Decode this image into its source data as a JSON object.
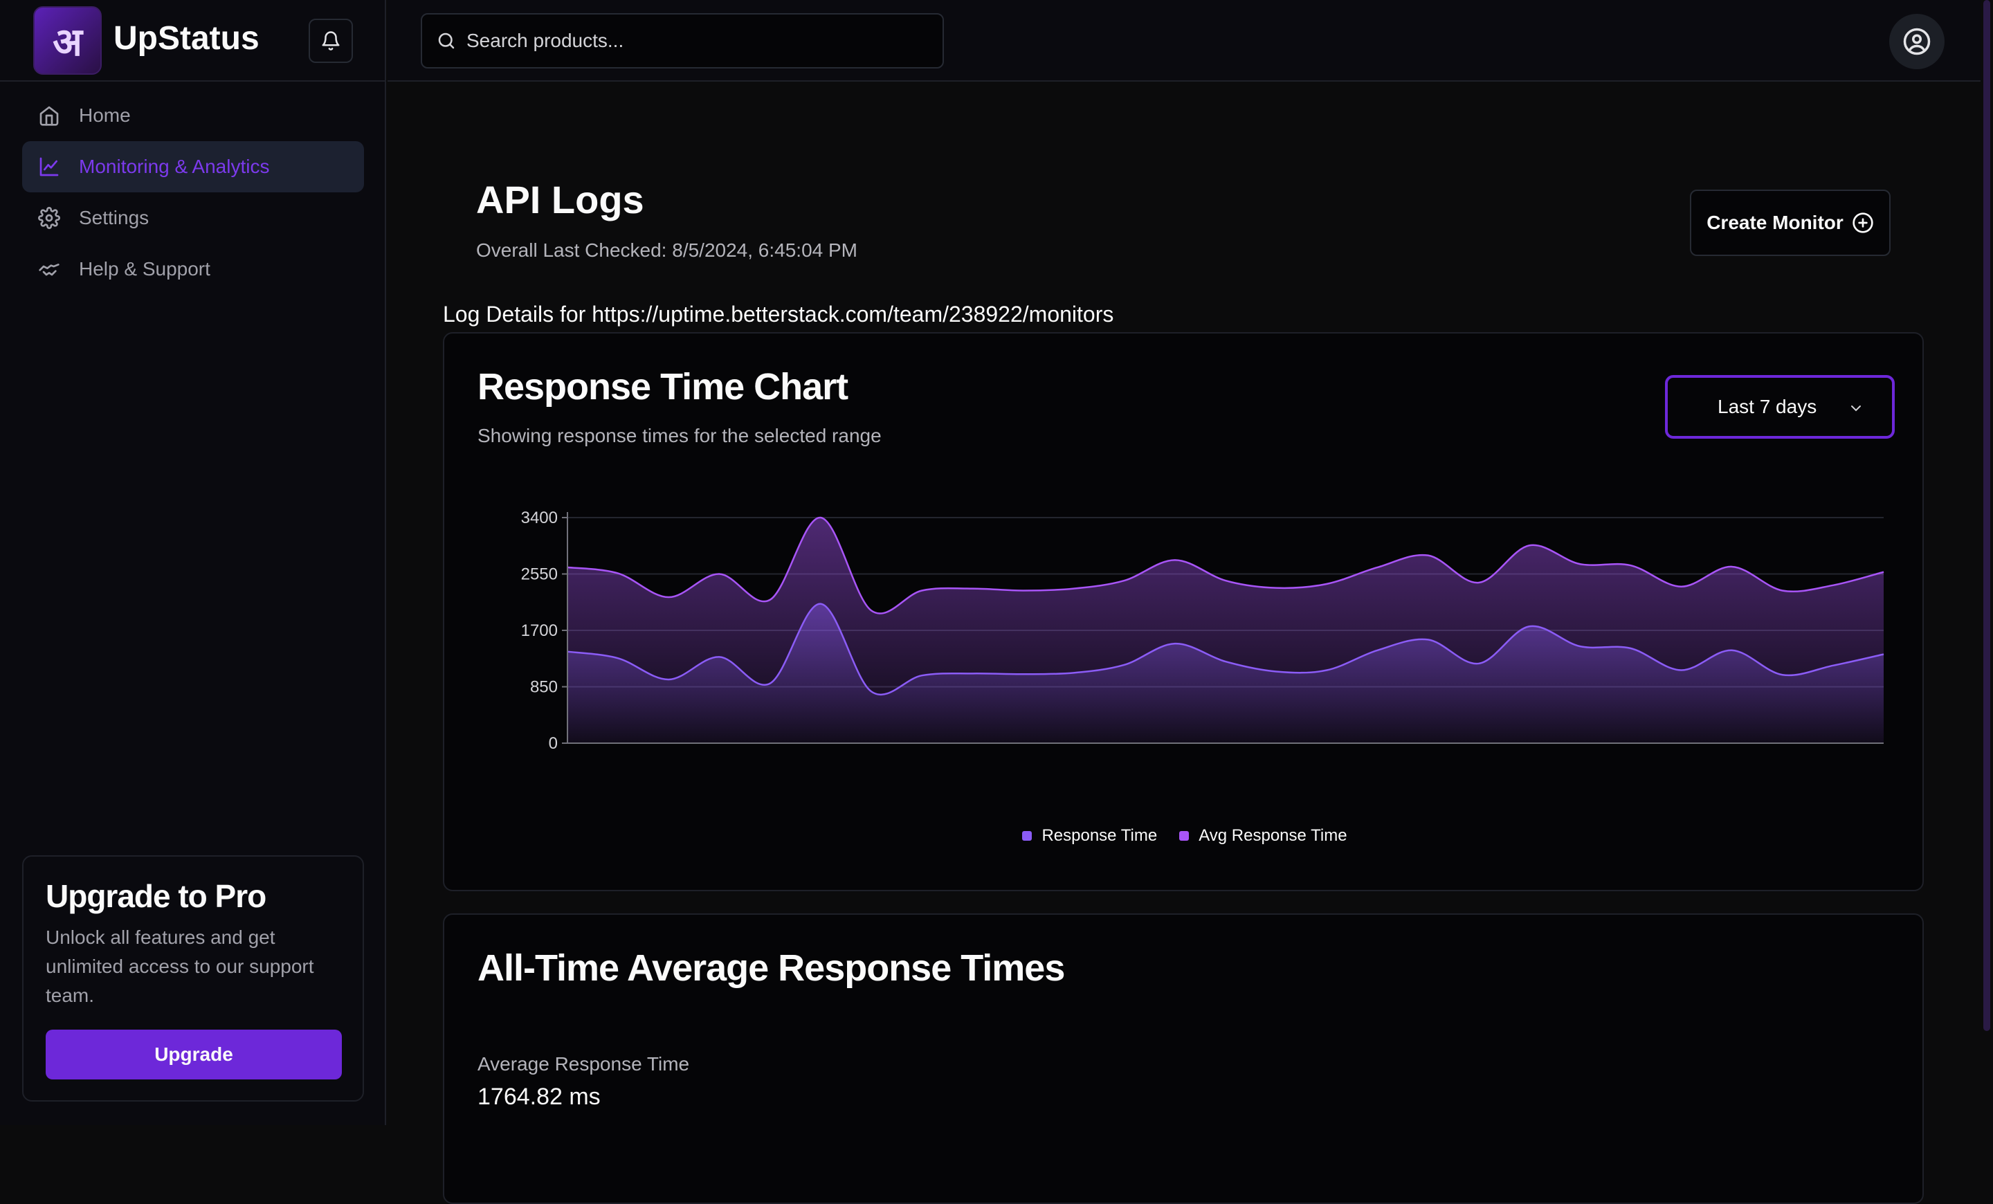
{
  "app": {
    "name": "UpStatus",
    "logo_text": "अ"
  },
  "sidebar": {
    "items": [
      {
        "label": "Home",
        "icon": "home-icon",
        "active": false
      },
      {
        "label": "Monitoring & Analytics",
        "icon": "chart-line-icon",
        "active": true
      },
      {
        "label": "Settings",
        "icon": "gear-icon",
        "active": false
      },
      {
        "label": "Help & Support",
        "icon": "handshake-icon",
        "active": false
      }
    ],
    "upgrade": {
      "title": "Upgrade to Pro",
      "text": "Unlock all features and get unlimited access to our support team.",
      "button": "Upgrade"
    }
  },
  "topbar": {
    "search_placeholder": "Search products..."
  },
  "page": {
    "title": "API Logs",
    "last_checked": "Overall Last Checked: 8/5/2024, 6:45:04 PM",
    "create_button": "Create Monitor",
    "log_details": "Log Details for https://uptime.betterstack.com/team/238922/monitors"
  },
  "chart_card": {
    "title": "Response Time Chart",
    "subtitle": "Showing response times for the selected range",
    "range": "Last 7 days"
  },
  "chart_data": {
    "type": "area",
    "yticks": [
      "0",
      "850",
      "1700",
      "2550",
      "3400"
    ],
    "ylim": [
      0,
      3400
    ],
    "grid": true,
    "legend_position": "bottom",
    "series": [
      {
        "name": "Response Time",
        "color": "#8b5cf6",
        "values": [
          1380,
          1280,
          960,
          1300,
          900,
          2100,
          780,
          1020,
          1050,
          1040,
          1060,
          1180,
          1500,
          1230,
          1080,
          1100,
          1400,
          1560,
          1200,
          1760,
          1460,
          1430,
          1100,
          1400,
          1030,
          1170,
          1340
        ]
      },
      {
        "name": "Avg Response Time",
        "color": "#a855f7",
        "values": [
          2650,
          2560,
          2200,
          2550,
          2160,
          3400,
          2000,
          2300,
          2330,
          2300,
          2330,
          2450,
          2760,
          2450,
          2340,
          2400,
          2650,
          2830,
          2420,
          2980,
          2700,
          2680,
          2360,
          2660,
          2300,
          2380,
          2580
        ]
      }
    ]
  },
  "avg_card": {
    "title": "All-Time Average Response Times",
    "label": "Average Response Time",
    "value": "1764.82 ms"
  },
  "colors": {
    "accent": "#6d28d9",
    "accent_text": "#7c3aed",
    "background": "#0b0b0c"
  }
}
